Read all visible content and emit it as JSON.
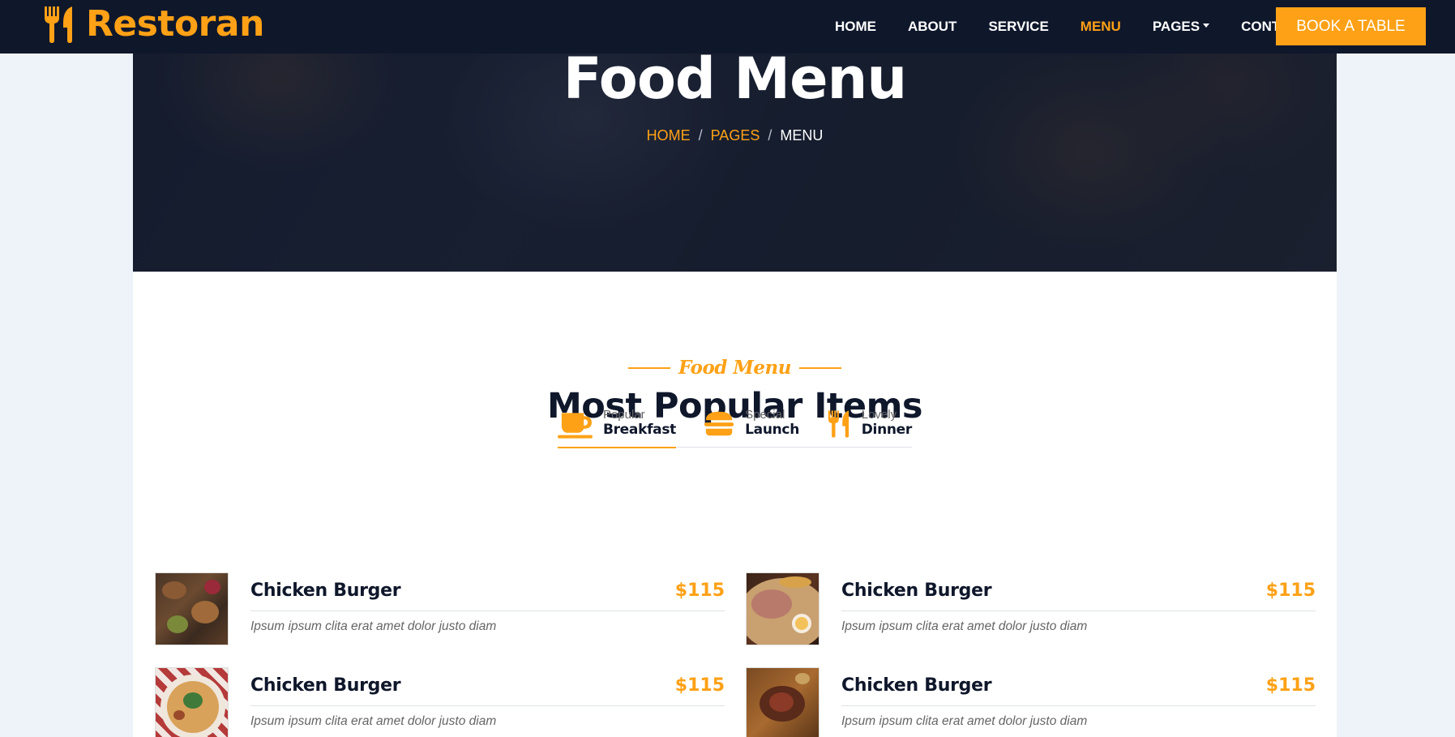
{
  "brand": {
    "name": "Restoran",
    "icon": "utensils-icon"
  },
  "nav": {
    "items": [
      {
        "label": "HOME",
        "active": false
      },
      {
        "label": "ABOUT",
        "active": false
      },
      {
        "label": "SERVICE",
        "active": false
      },
      {
        "label": "MENU",
        "active": true
      },
      {
        "label": "PAGES",
        "active": false,
        "dropdown": true
      },
      {
        "label": "CONTACT",
        "active": false
      }
    ],
    "cta": "BOOK A TABLE"
  },
  "hero": {
    "title": "Food Menu",
    "breadcrumb": [
      "HOME",
      "PAGES",
      "MENU"
    ],
    "separator": "/"
  },
  "section": {
    "subtitle": "Food Menu",
    "title": "Most Popular Items"
  },
  "tabs": [
    {
      "small": "Popular",
      "big": "Breakfast",
      "icon": "coffee-icon",
      "active": true
    },
    {
      "small": "Special",
      "big": "Launch",
      "icon": "hamburger-icon",
      "active": false
    },
    {
      "small": "Lovely",
      "big": "Dinner",
      "icon": "utensils-icon",
      "active": false
    }
  ],
  "menu_items": [
    {
      "name": "Chicken Burger",
      "price": "$115",
      "desc": "Ipsum ipsum clita erat amet dolor justo diam",
      "image": "grilled-platter-photo"
    },
    {
      "name": "Chicken Burger",
      "price": "$115",
      "desc": "Ipsum ipsum clita erat amet dolor justo diam",
      "image": "ramen-bowl-photo"
    },
    {
      "name": "Chicken Burger",
      "price": "$115",
      "desc": "Ipsum ipsum clita erat amet dolor justo diam",
      "image": "pizza-photo"
    },
    {
      "name": "Chicken Burger",
      "price": "$115",
      "desc": "Ipsum ipsum clita erat amet dolor justo diam",
      "image": "steak-photo"
    }
  ],
  "colors": {
    "accent": "#fea116",
    "dark": "#0f172b",
    "muted": "#666565",
    "page_bg": "#eef3fa"
  }
}
